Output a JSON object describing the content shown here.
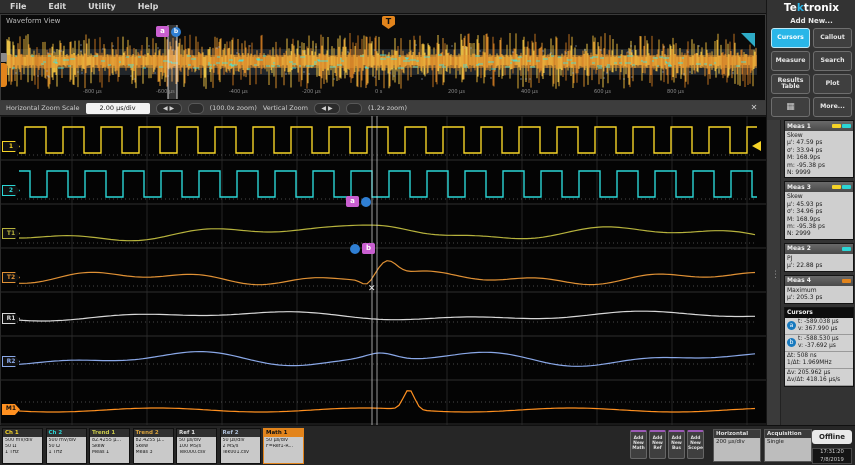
{
  "brand": "Tektronix",
  "menu": {
    "items": [
      "File",
      "Edit",
      "Utility",
      "Help"
    ]
  },
  "overview": {
    "title": "Waveform View",
    "axis_labels": [
      "-800 µs",
      "-600 µs",
      "-400 µs",
      "-200 µs",
      "0 s",
      "200 µs",
      "400 µs",
      "600 µs",
      "800 µs"
    ],
    "trigger_label": "T",
    "cursor_a_label": "a",
    "cursor_b_label": "b"
  },
  "zoom_bar": {
    "label": "Horizontal Zoom Scale",
    "scale_value": "2.00 µs/div",
    "stepper_icon": "◀ ▶",
    "h_zoom_readout": "(100.0x zoom)",
    "vertical_label": "Vertical Zoom",
    "v_zoom_readout": "(1.2x zoom)",
    "close_icon": "✕"
  },
  "traces": [
    {
      "handle": "1",
      "name": "channel-1",
      "color": "#f5d327",
      "type": "square"
    },
    {
      "handle": "2",
      "name": "channel-2",
      "color": "#2bd5d5",
      "type": "square"
    },
    {
      "handle": "T1",
      "name": "trend-1",
      "color": "#b7b33d",
      "type": "trend"
    },
    {
      "handle": "T2",
      "name": "trend-2",
      "color": "#e09135",
      "type": "trend"
    },
    {
      "handle": "R1",
      "name": "ref-1",
      "color": "#d8d8d8",
      "type": "ref"
    },
    {
      "handle": "R2",
      "name": "ref-2",
      "color": "#8aa8e8",
      "type": "ref"
    },
    {
      "handle": "M1",
      "name": "math-1",
      "color": "#ff9020",
      "type": "math"
    }
  ],
  "sidebar": {
    "add_new_label": "Add New...",
    "buttons": [
      {
        "label": "Cursors",
        "active": true
      },
      {
        "label": "Callout"
      },
      {
        "label": "Measure"
      },
      {
        "label": "Search"
      },
      {
        "label": "Results Table"
      },
      {
        "label": "Plot"
      },
      {
        "label": "",
        "icon": "mask-test-icon"
      },
      {
        "label": "More..."
      }
    ],
    "meas_panels": [
      {
        "title": "Meas 1",
        "chips": [
          "#f5d327",
          "#2bd5d5"
        ],
        "lines": [
          "Skew",
          "µ': 47.59 ps",
          "σ': 33.94 ps",
          "M: 168.9ps",
          "m: -95.38 ps",
          "N: 9999"
        ]
      },
      {
        "title": "Meas 3",
        "chips": [
          "#f5d327",
          "#2bd5d5"
        ],
        "lines": [
          "Skew",
          "µ': 45.93 ps",
          "σ': 34.96 ps",
          "M: 168.9ps",
          "m: -95.38 ps",
          "N: 2999"
        ]
      },
      {
        "title": "Meas 2",
        "chips": [
          "#2bd5d5"
        ],
        "lines": [
          "PJ",
          "µ': 22.88 ps"
        ]
      },
      {
        "title": "Meas 4",
        "chips": [
          "#e2841c"
        ],
        "lines": [
          "Maximum",
          "µ': 205.3 ps"
        ]
      }
    ],
    "cursors_panel": {
      "title": "Cursors",
      "a_icon": "a",
      "b_icon": "b",
      "a_lines": [
        "t: -589.038 µs",
        "v: 367.990 µs"
      ],
      "b_lines": [
        "t: -588.530 µs",
        "v: -37.692 µs"
      ],
      "delta_lines": [
        "Δt: 508 ns",
        "1/Δt: 1.969MHz"
      ],
      "delta_lines_2": [
        "Δv: 205.962 µs",
        "Δv/Δt: 418.16 µs/s"
      ]
    }
  },
  "bottom": {
    "badges": [
      {
        "title": "Ch 1",
        "color": "#f5d327",
        "lines": [
          "500 mV/div",
          "50 Ω",
          "1 THz"
        ]
      },
      {
        "title": "Ch 2",
        "color": "#2bd5d5",
        "lines": [
          "500 mV/div",
          "50 Ω",
          "1 THz"
        ]
      },
      {
        "title": "Trend 1",
        "color": "#c9c94a",
        "lines": [
          "82.4255 µ...",
          "Skew",
          "Meas 1"
        ]
      },
      {
        "title": "Trend 2",
        "color": "#d9a23c",
        "lines": [
          "82.4255 µ...",
          "Skew",
          "Meas 3"
        ]
      },
      {
        "title": "Ref 1",
        "color": "#e0e0e0",
        "lines": [
          "50 µs/div",
          "100 MS/s",
          "Tek000.csv"
        ]
      },
      {
        "title": "Ref 2",
        "color": "#aebfd8",
        "lines": [
          "50 µs/div",
          "2 MS/s",
          "Tek001.csv"
        ]
      },
      {
        "title": "Math 1",
        "color": "#111111",
        "header_bg": "#e2841c",
        "selected": true,
        "lines": [
          "50 µs/div",
          "F=Ref1-R..."
        ]
      }
    ],
    "add_buttons": [
      "Add New Math",
      "Add New Ref",
      "Add New Bus",
      "Add New Scope"
    ],
    "horizontal": {
      "title": "Horizontal",
      "value": "200 µs/div"
    },
    "acquisition": {
      "title": "Acquisition",
      "value": "Single"
    },
    "offline_label": "Offline",
    "clock": {
      "time": "17:31:20",
      "date": "7/8/2019"
    }
  }
}
